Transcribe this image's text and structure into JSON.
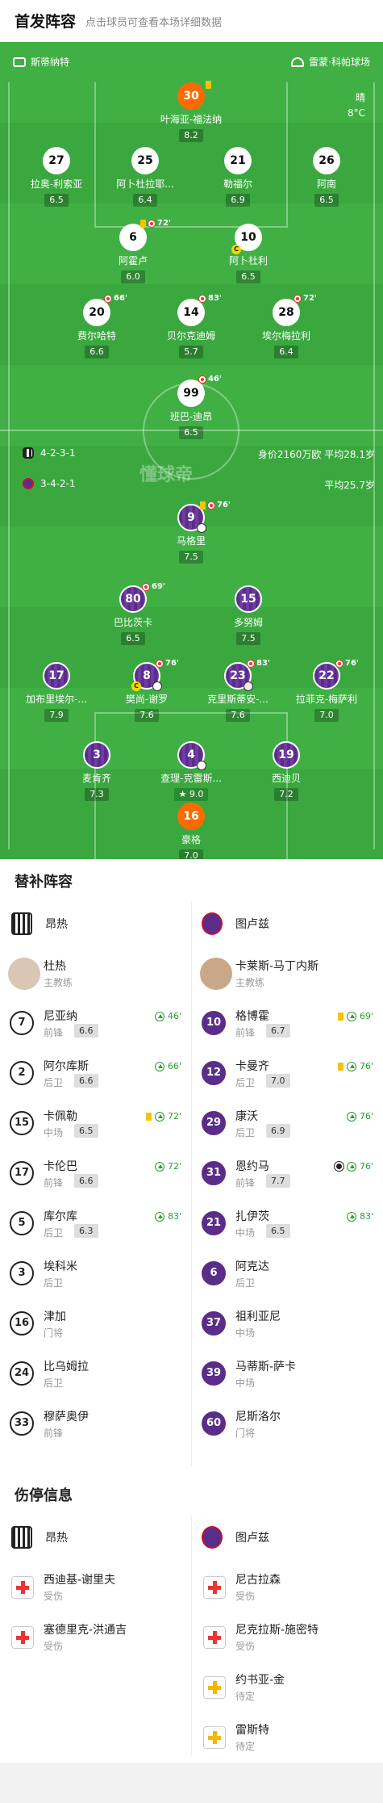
{
  "header": {
    "title": "首发阵容",
    "subtitle": "点击球员可查看本场详细数据"
  },
  "pitch": {
    "home_team": "斯蒂纳特",
    "away_team": "雷蒙·科帕球场",
    "weather": "晴",
    "temperature": "8°C",
    "home_formation": "4-2-3-1",
    "away_formation": "3-4-2-1",
    "home_value": "身价2160万欧",
    "home_age": "平均28.1岁",
    "away_age": "平均25.7岁",
    "watermark": "懂球帝"
  },
  "home_players": [
    {
      "num": "30",
      "name": "叶海亚-福法纳",
      "rating": "8.2",
      "sub": ""
    },
    {
      "num": "27",
      "name": "拉奥-利索亚",
      "rating": "6.5",
      "sub": ""
    },
    {
      "num": "25",
      "name": "阿卜杜拉耶...",
      "rating": "6.4",
      "sub": ""
    },
    {
      "num": "21",
      "name": "勒福尔",
      "rating": "6.9",
      "sub": ""
    },
    {
      "num": "26",
      "name": "阿南",
      "rating": "6.5",
      "sub": ""
    },
    {
      "num": "6",
      "name": "阿霍卢",
      "rating": "6.0",
      "sub": "72'"
    },
    {
      "num": "10",
      "name": "阿卜杜利",
      "rating": "6.5",
      "sub": ""
    },
    {
      "num": "20",
      "name": "费尔哈特",
      "rating": "6.6",
      "sub": "66'"
    },
    {
      "num": "14",
      "name": "贝尔克迪姆",
      "rating": "5.7",
      "sub": "83'"
    },
    {
      "num": "28",
      "name": "埃尔梅拉利",
      "rating": "6.4",
      "sub": "72'"
    },
    {
      "num": "99",
      "name": "班巴-迪昂",
      "rating": "6.5",
      "sub": "46'"
    }
  ],
  "away_players": [
    {
      "num": "9",
      "name": "马格里",
      "rating": "7.5",
      "sub": "76'"
    },
    {
      "num": "80",
      "name": "巴比茨卡",
      "rating": "6.5",
      "sub": "69'"
    },
    {
      "num": "15",
      "name": "多努姆",
      "rating": "7.5",
      "sub": ""
    },
    {
      "num": "17",
      "name": "加布里埃尔-...",
      "rating": "7.9",
      "sub": ""
    },
    {
      "num": "8",
      "name": "樊尚-谢罗",
      "rating": "7.6",
      "sub": "76'"
    },
    {
      "num": "23",
      "name": "克里斯蒂安-...",
      "rating": "7.6",
      "sub": "83'"
    },
    {
      "num": "22",
      "name": "拉菲克-梅萨利",
      "rating": "7.0",
      "sub": "76'"
    },
    {
      "num": "3",
      "name": "麦肯齐",
      "rating": "7.3",
      "sub": ""
    },
    {
      "num": "4",
      "name": "查理-克雷斯...",
      "rating": "9.0",
      "sub": ""
    },
    {
      "num": "19",
      "name": "西迪贝",
      "rating": "7.2",
      "sub": ""
    },
    {
      "num": "16",
      "name": "豪格",
      "rating": "7.0",
      "sub": ""
    }
  ],
  "subs": {
    "title": "替补阵容",
    "home_team": "昂热",
    "away_team": "图卢兹",
    "home_coach": {
      "name": "杜热",
      "role": "主教练"
    },
    "away_coach": {
      "name": "卡莱斯-马丁内斯",
      "role": "主教练"
    },
    "home": [
      {
        "num": "7",
        "name": "尼亚纳",
        "pos": "前锋",
        "rating": "6.6",
        "ev": "46'"
      },
      {
        "num": "2",
        "name": "阿尔库斯",
        "pos": "后卫",
        "rating": "6.6",
        "ev": "66'"
      },
      {
        "num": "15",
        "name": "卡佩勒",
        "pos": "中场",
        "rating": "6.5",
        "ev": "72'"
      },
      {
        "num": "17",
        "name": "卡伦巴",
        "pos": "前锋",
        "rating": "6.6",
        "ev": "72'"
      },
      {
        "num": "5",
        "name": "库尔库",
        "pos": "后卫",
        "rating": "6.3",
        "ev": "83'"
      },
      {
        "num": "3",
        "name": "埃科米",
        "pos": "后卫",
        "rating": "",
        "ev": ""
      },
      {
        "num": "16",
        "name": "津加",
        "pos": "门将",
        "rating": "",
        "ev": ""
      },
      {
        "num": "24",
        "name": "比乌姆拉",
        "pos": "后卫",
        "rating": "",
        "ev": ""
      },
      {
        "num": "33",
        "name": "穆萨奥伊",
        "pos": "前锋",
        "rating": "",
        "ev": ""
      }
    ],
    "away": [
      {
        "num": "10",
        "name": "格博霍",
        "pos": "前锋",
        "rating": "6.7",
        "ev": "69'"
      },
      {
        "num": "12",
        "name": "卡曼齐",
        "pos": "后卫",
        "rating": "7.0",
        "ev": "76'"
      },
      {
        "num": "29",
        "name": "康沃",
        "pos": "后卫",
        "rating": "6.9",
        "ev": "76'"
      },
      {
        "num": "31",
        "name": "恩约马",
        "pos": "前锋",
        "rating": "7.7",
        "ev": "76'"
      },
      {
        "num": "21",
        "name": "扎伊茨",
        "pos": "中场",
        "rating": "6.5",
        "ev": "83'"
      },
      {
        "num": "6",
        "name": "阿克达",
        "pos": "后卫",
        "rating": "",
        "ev": ""
      },
      {
        "num": "37",
        "name": "祖利亚尼",
        "pos": "中场",
        "rating": "",
        "ev": ""
      },
      {
        "num": "39",
        "name": "马蒂斯-萨卡",
        "pos": "中场",
        "rating": "",
        "ev": ""
      },
      {
        "num": "60",
        "name": "尼斯洛尔",
        "pos": "门将",
        "rating": "",
        "ev": ""
      }
    ]
  },
  "injuries": {
    "title": "伤停信息",
    "home_team": "昂热",
    "away_team": "图卢兹",
    "home": [
      {
        "name": "西迪基-谢里夫",
        "status": "受伤"
      },
      {
        "name": "塞德里克-洪通吉",
        "status": "受伤"
      }
    ],
    "away": [
      {
        "name": "尼古拉森",
        "status": "受伤"
      },
      {
        "name": "尼克拉斯-施密特",
        "status": "受伤"
      },
      {
        "name": "约书亚-金",
        "status": "待定"
      },
      {
        "name": "雷斯特",
        "status": "待定"
      }
    ]
  }
}
